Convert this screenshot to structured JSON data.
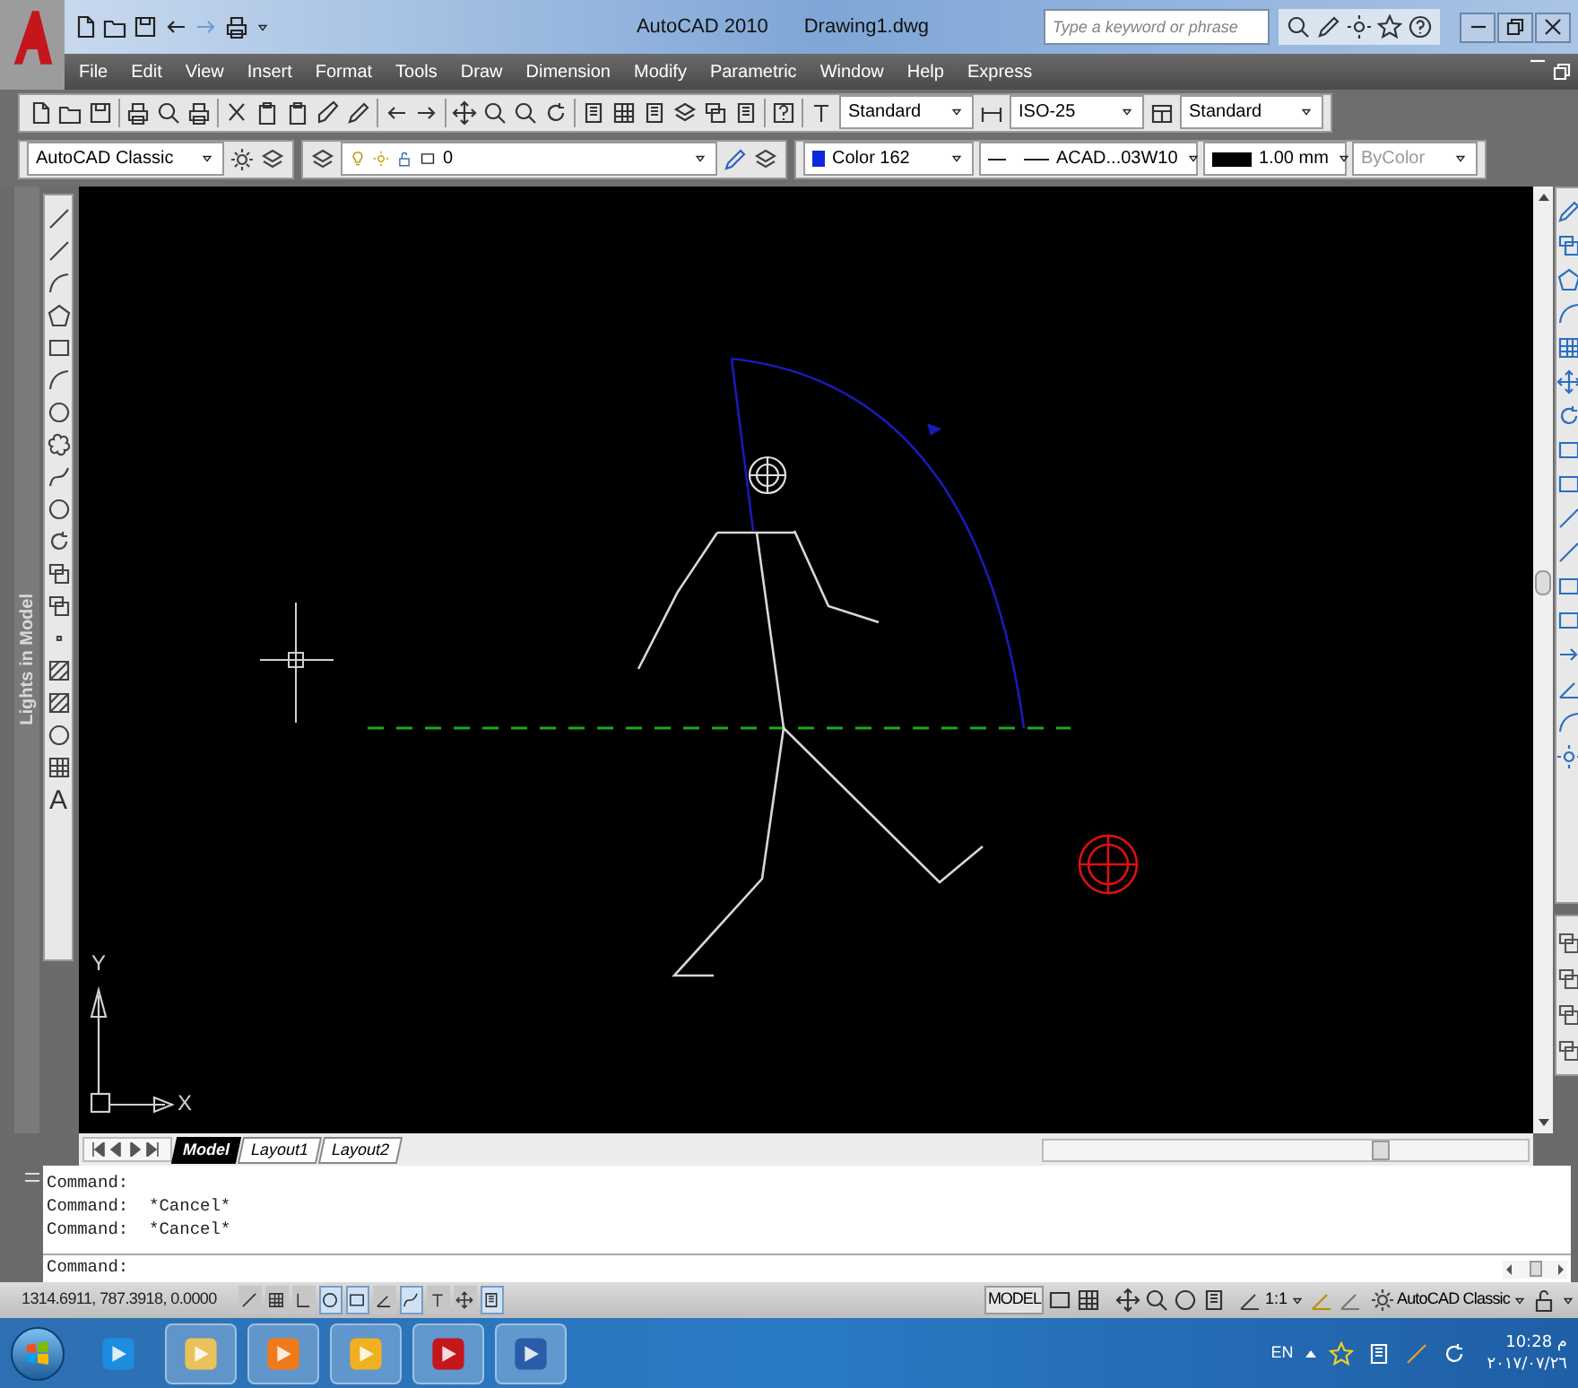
{
  "title_bar": {
    "app": "AutoCAD 2010",
    "document": "Drawing1.dwg",
    "search": {
      "placeholder": "Type a keyword or phrase"
    }
  },
  "menu_bar": [
    "File",
    "Edit",
    "View",
    "Insert",
    "Format",
    "Tools",
    "Draw",
    "Dimension",
    "Modify",
    "Parametric",
    "Window",
    "Help",
    "Express"
  ],
  "toolbars": {
    "text_style": "Standard",
    "dim_style": "ISO-25",
    "table_style": "Standard",
    "workspace": "AutoCAD Classic",
    "layer": "0",
    "color": {
      "label": "Color 162",
      "color": "#0a2ad8"
    },
    "linetype": "ACAD...03W10",
    "lineweight": "1.00 mm",
    "plot_style": {
      "label": "ByColor",
      "disabled": true
    }
  },
  "side_panel": {
    "title": "Lights in Model"
  },
  "draw_toolbar": {
    "text_tool": "A"
  },
  "canvas": {
    "ucs": {
      "x": "X",
      "y": "Y"
    }
  },
  "layout_tabs": [
    {
      "label": "Model",
      "selected": true
    },
    {
      "label": "Layout1",
      "selected": false
    },
    {
      "label": "Layout2",
      "selected": false
    }
  ],
  "command_history": [
    "Command:",
    "Command:  *Cancel*",
    "Command:  *Cancel*"
  ],
  "command_line": "Command:",
  "status_bar": {
    "coordinates": "1314.6911, 787.3918, 0.0000",
    "toggles": [
      {
        "on": false
      },
      {
        "on": false
      },
      {
        "on": false
      },
      {
        "on": true
      },
      {
        "on": true
      },
      {
        "on": false
      },
      {
        "on": true
      },
      {
        "on": false
      },
      {
        "on": false
      },
      {
        "on": true
      }
    ],
    "model": "MODEL",
    "annotation_scale": "1:1",
    "workspace": "AutoCAD Classic"
  },
  "taskbar": {
    "language": "EN",
    "time": "10:28 م",
    "date": "٢٠١٧/٠٧/٢٦"
  }
}
